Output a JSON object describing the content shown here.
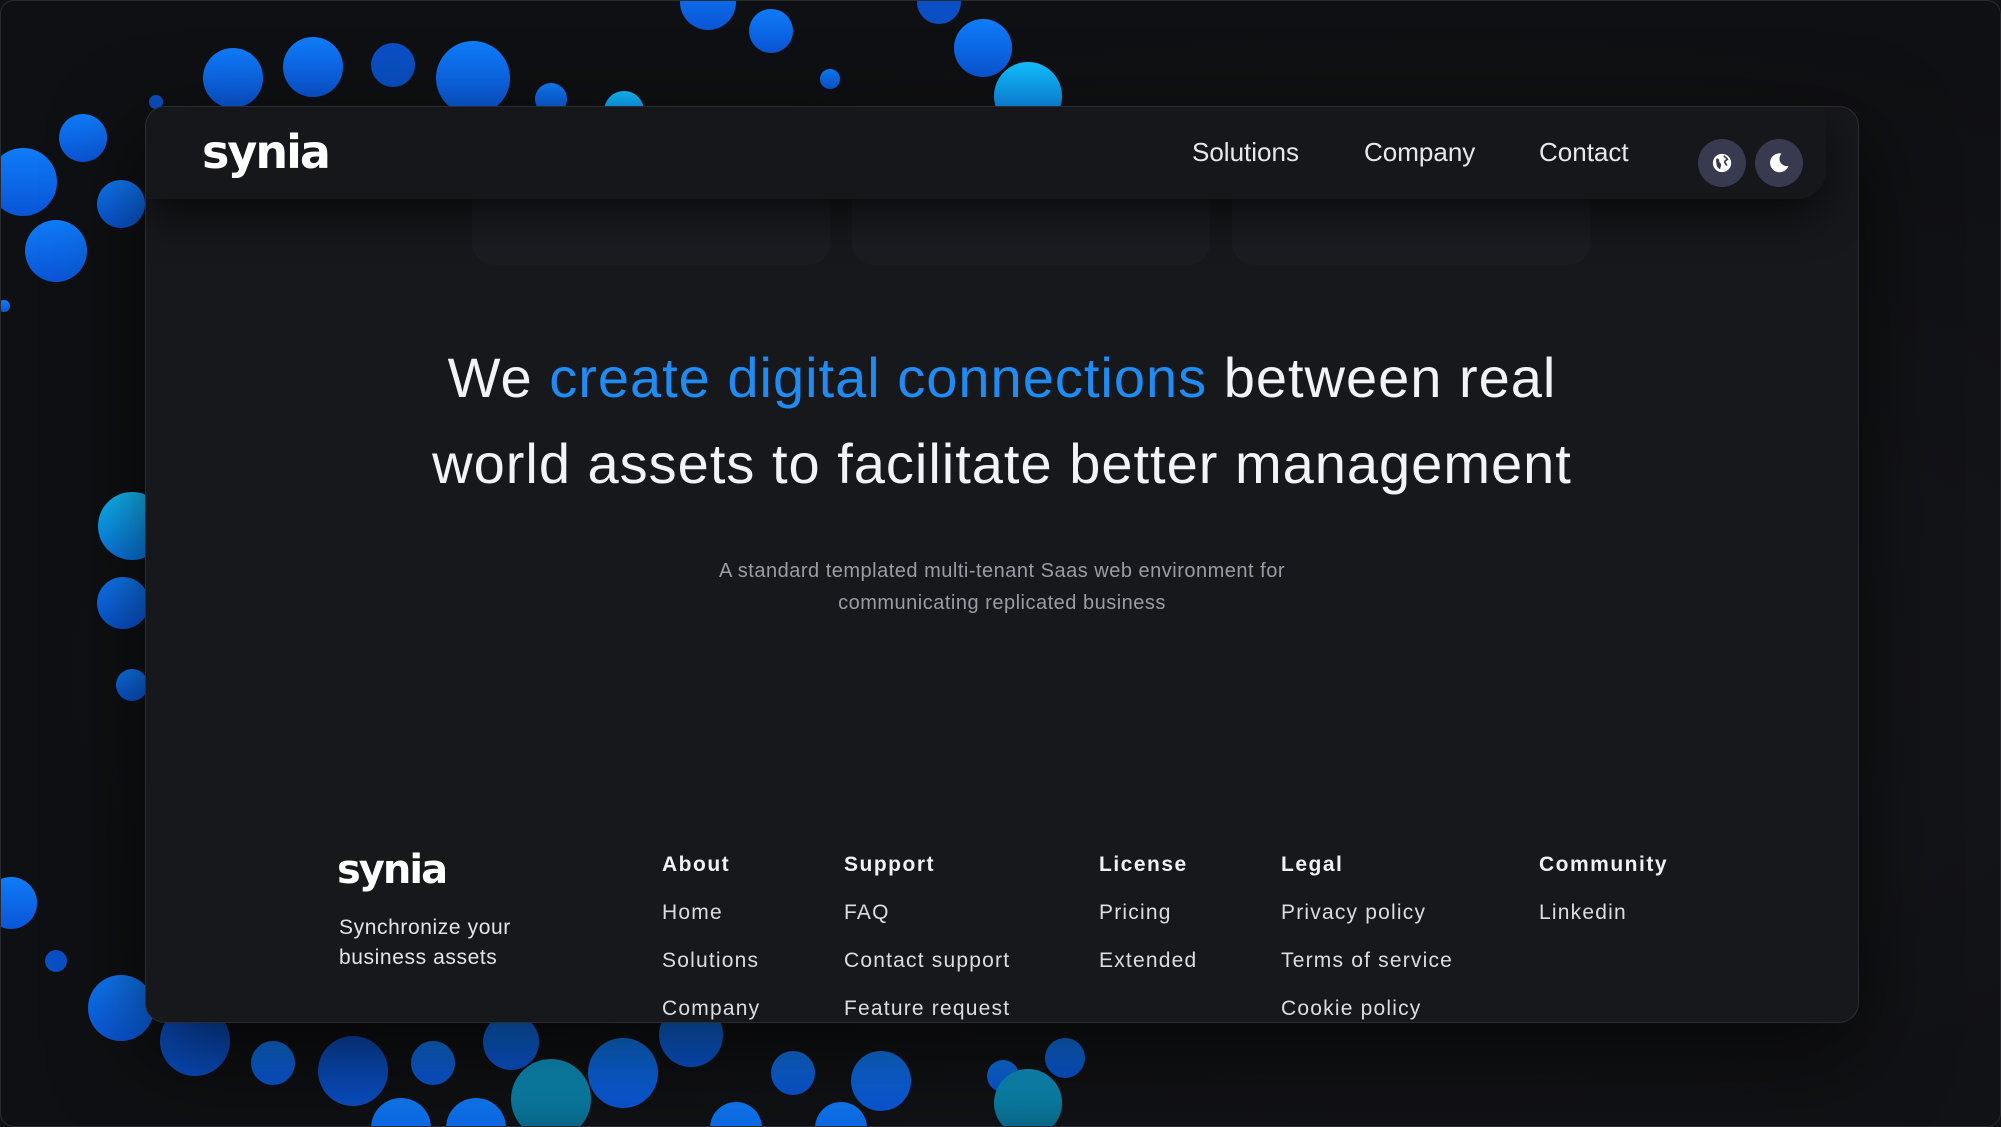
{
  "nav": {
    "brand": "synia",
    "links": [
      "Solutions",
      "Company",
      "Contact"
    ],
    "buttons": [
      {
        "icon": "globe-icon"
      },
      {
        "icon": "moon-icon"
      }
    ]
  },
  "hero": {
    "lead": "We ",
    "accent": "create digital connections",
    "rest_line1": " between real",
    "line2": "world assets to facilitate better management",
    "subtitle_line1": "A standard templated multi-tenant Saas web environment for",
    "subtitle_line2": "communicating replicated business"
  },
  "footer": {
    "brand": "synia",
    "tagline": "Synchronize your business assets",
    "columns": [
      {
        "title": "About",
        "links": [
          "Home",
          "Solutions",
          "Company"
        ]
      },
      {
        "title": "Support",
        "links": [
          "FAQ",
          "Contact support",
          "Feature request"
        ]
      },
      {
        "title": "License",
        "links": [
          "Pricing",
          "Extended"
        ]
      },
      {
        "title": "Legal",
        "links": [
          "Privacy policy",
          "Terms of service",
          "Cookie policy"
        ]
      },
      {
        "title": "Community",
        "links": [
          "Linkedin"
        ]
      }
    ]
  },
  "colors": {
    "accent": "#1f8cf4",
    "dot_blue": "#0a6cf0",
    "dot_cyan": "#0ab4f2",
    "background": "#111215"
  }
}
